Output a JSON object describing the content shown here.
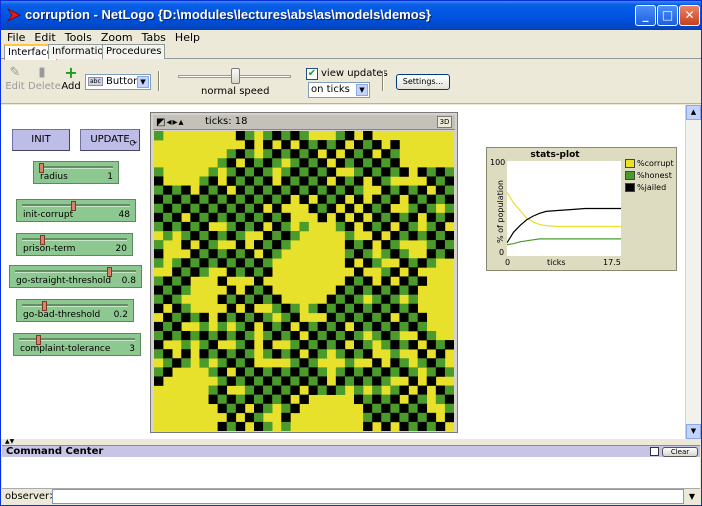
{
  "window": {
    "title": "corruption - NetLogo {D:\\modules\\lectures\\abs\\as\\models\\demos}",
    "controls": {
      "minimize": "_",
      "maximize": "□",
      "close": "✕"
    }
  },
  "menu": [
    "File",
    "Edit",
    "Tools",
    "Zoom",
    "Tabs",
    "Help"
  ],
  "tabs": [
    "Interface",
    "Information",
    "Procedures"
  ],
  "toolbar": {
    "edit_label": "Edit",
    "delete_label": "Delete",
    "add_label": "Add",
    "widget_type": "Button",
    "widget_type_badge": "abc",
    "speed_label": "normal speed",
    "speed_fraction": 0.5,
    "view_updates_label": "view updates",
    "view_updates_checked": true,
    "update_mode": "on ticks",
    "settings_label": "Settings..."
  },
  "buttons": {
    "init": "INIT",
    "update": "UPDATE",
    "forever_icon": "⟳"
  },
  "sliders": [
    {
      "label": "radius",
      "value": "1",
      "fraction": 0.0
    },
    {
      "label": "init-corrupt",
      "value": "48",
      "fraction": 0.48
    },
    {
      "label": "prison-term",
      "value": "20",
      "fraction": 0.18
    },
    {
      "label": "go-straight-threshold",
      "value": "0.8",
      "fraction": 0.8
    },
    {
      "label": "go-bad-threshold",
      "value": "0.2",
      "fraction": 0.2
    },
    {
      "label": "complaint-tolerance",
      "value": "3",
      "fraction": 0.15
    }
  ],
  "view": {
    "ticks_label": "ticks: 18",
    "btn_3d": "3D",
    "colors": {
      "corrupt": "#e8e12c",
      "honest": "#4a9a2c",
      "jailed": "#000000"
    }
  },
  "chart_data": {
    "type": "line",
    "title": "stats-plot",
    "xlabel": "ticks",
    "ylabel": "% of population",
    "xlim": [
      0,
      17.5
    ],
    "ylim": [
      0,
      100
    ],
    "x_ticks": [
      "0",
      "17.5"
    ],
    "y_ticks": [
      "100",
      "0"
    ],
    "legend_position": "right",
    "series": [
      {
        "name": "%corrupt",
        "color": "#e8e12c",
        "x": [
          0,
          1,
          2,
          3,
          4,
          5,
          6,
          8,
          10,
          12,
          14,
          17.5
        ],
        "values": [
          67,
          56,
          48,
          40,
          36,
          33,
          32,
          31,
          31,
          31,
          31,
          31
        ]
      },
      {
        "name": "%honest",
        "color": "#4a9a2c",
        "x": [
          0,
          1,
          2,
          3,
          4,
          5,
          6,
          8,
          10,
          12,
          14,
          17.5
        ],
        "values": [
          12,
          13,
          15,
          16,
          17,
          18,
          18,
          18,
          18,
          18,
          18,
          18
        ]
      },
      {
        "name": "%jailed",
        "color": "#000000",
        "x": [
          0,
          1,
          2,
          3,
          4,
          5,
          6,
          8,
          10,
          12,
          14,
          17.5
        ],
        "values": [
          14,
          25,
          32,
          38,
          42,
          45,
          47,
          48,
          49,
          50,
          50,
          50
        ]
      }
    ]
  },
  "command_center": {
    "title": "Command Center",
    "clear_label": "Clear",
    "prompt": "observer>",
    "command_value": ""
  }
}
